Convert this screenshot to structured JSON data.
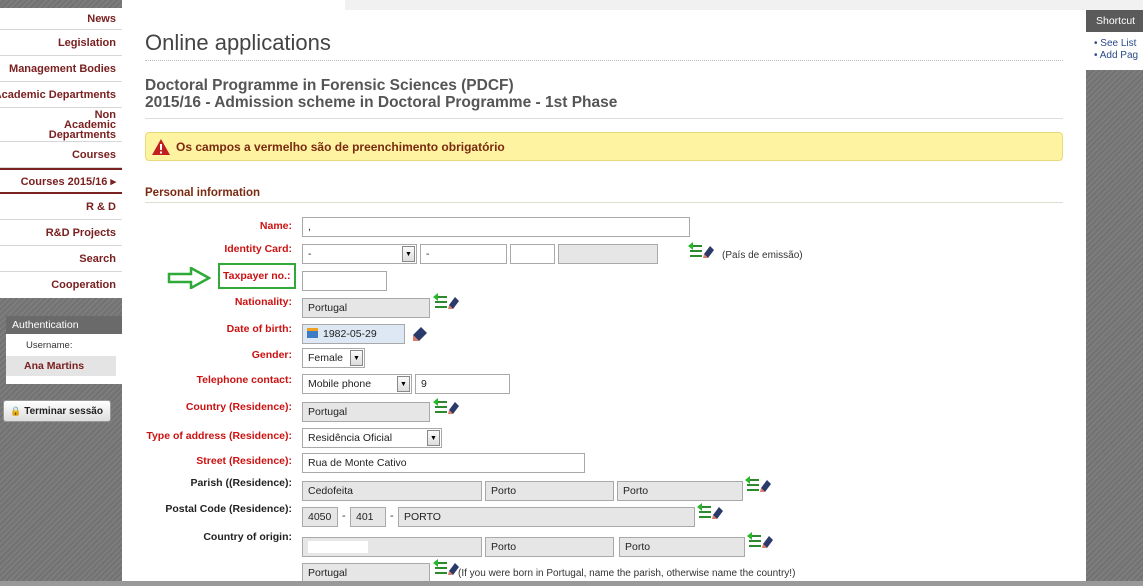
{
  "nav": {
    "items": [
      {
        "label": "News"
      },
      {
        "label": "Legislation"
      },
      {
        "label": "Management Bodies"
      },
      {
        "label": "Academic Departments"
      },
      {
        "label": "Non Academic Departments"
      },
      {
        "label": "Courses"
      },
      {
        "label": "Courses 2015/16 ▸"
      },
      {
        "label": "R & D"
      },
      {
        "label": "R&D Projects"
      },
      {
        "label": "Search"
      },
      {
        "label": "Cooperation"
      }
    ]
  },
  "auth": {
    "title": "Authentication",
    "username_label": "Username:",
    "username": "Ana Martins",
    "logout": "Terminar sessão"
  },
  "shortcuts": {
    "title": "Shortcut",
    "links": [
      "• See List",
      "• Add Pag"
    ]
  },
  "page": {
    "title": "Online applications",
    "programme_line1": "Doctoral Programme in Forensic Sciences (PDCF)",
    "programme_line2": "2015/16 - Admission scheme in Doctoral Programme - 1st Phase",
    "alert": "Os campos a vermelho são de preenchimento obrigatório",
    "section": "Personal information"
  },
  "form": {
    "name_label": "Name:",
    "name_value": ",",
    "idcard_label": "Identity Card:",
    "idcard_type": "-",
    "idcard_num": "-",
    "idcard_country_hint": "(País de emissão)",
    "taxpayer_label": "Taxpayer no.:",
    "nationality_label": "Nationality:",
    "nationality_value": "Portugal",
    "dob_label": "Date of birth:",
    "dob_value": "1982-05-29",
    "gender_label": "Gender:",
    "gender_value": "Female",
    "phone_label": "Telephone contact:",
    "phone_type": "Mobile phone",
    "phone_value": "9",
    "country_res_label": "Country (Residence):",
    "country_res_value": "Portugal",
    "addrtype_label": "Type of address (Residence):",
    "addrtype_value": "Residência Oficial",
    "street_label": "Street (Residence):",
    "street_value": "Rua de Monte Cativo",
    "parish_label": "Parish ((Residence):",
    "parish_value": "Cedofeita",
    "parish_city1": "Porto",
    "parish_city2": "Porto",
    "postal_label": "Postal Code (Residence):",
    "postal_a": "4050",
    "postal_b": "401",
    "postal_city": "PORTO",
    "origin_label": "Country of origin:",
    "origin_city1": "Porto",
    "origin_city2": "Porto",
    "origin_country": "Portugal",
    "origin_hint": "(If you were born in Portugal, name the parish, otherwise name the country!)"
  },
  "colors": {
    "required": "#cc1111",
    "accent": "#7a2020",
    "highlight": "#2faa3a"
  }
}
